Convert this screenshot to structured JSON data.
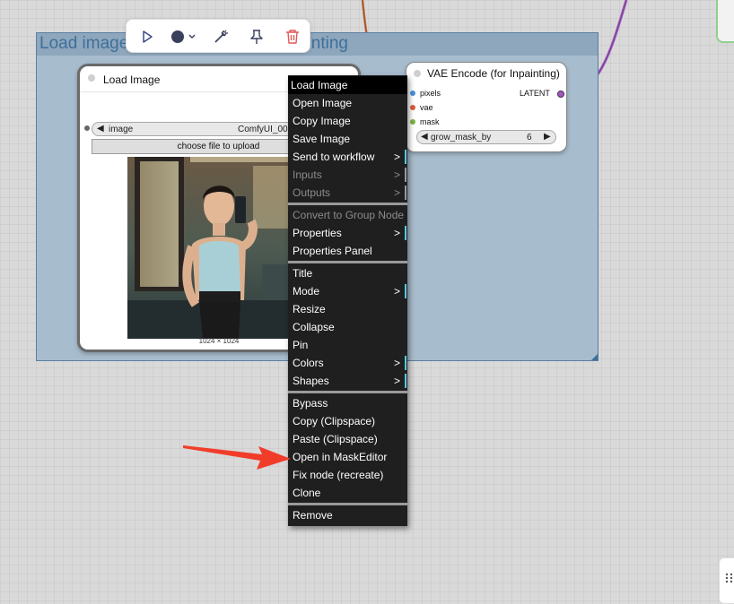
{
  "group": {
    "title": "Load image & VAE Encode for Inpainting"
  },
  "toolbar": {
    "run_icon": "play-icon",
    "color_icon": "color-circle-icon",
    "bypass_icon": "wand-icon",
    "pin_icon": "pin-icon",
    "delete_icon": "trash-icon",
    "accent": "#e05a5a"
  },
  "load_node": {
    "title": "Load Image",
    "image_label": "image",
    "image_value": "ComfyUI_008",
    "upload_label": "choose file to upload",
    "dimensions": "1024 × 1024"
  },
  "vae_node": {
    "title": "VAE Encode (for Inpainting)",
    "inputs": [
      "pixels",
      "vae",
      "mask"
    ],
    "output": "LATENT",
    "grow_label": "grow_mask_by",
    "grow_value": "6"
  },
  "menu": {
    "header": "Load Image",
    "items": [
      "Open Image",
      "Copy Image",
      "Save Image",
      "Send to workflow",
      "Inputs",
      "Outputs",
      "Convert to Group Node",
      "Properties",
      "Properties Panel",
      "Title",
      "Mode",
      "Resize",
      "Collapse",
      "Pin",
      "Colors",
      "Shapes",
      "Bypass",
      "Copy (Clipspace)",
      "Paste (Clipspace)",
      "Open in MaskEditor",
      "Fix node (recreate)",
      "Clone",
      "Remove"
    ],
    "submenu_arrow": ">"
  },
  "colors": {
    "pixels": "#4a90d9",
    "vae": "#e05a3c",
    "mask": "#7cb342",
    "latent": "#a05abf",
    "submenu_bar": "#5bc8e0",
    "annotation_arrow": "#f23c2a"
  }
}
